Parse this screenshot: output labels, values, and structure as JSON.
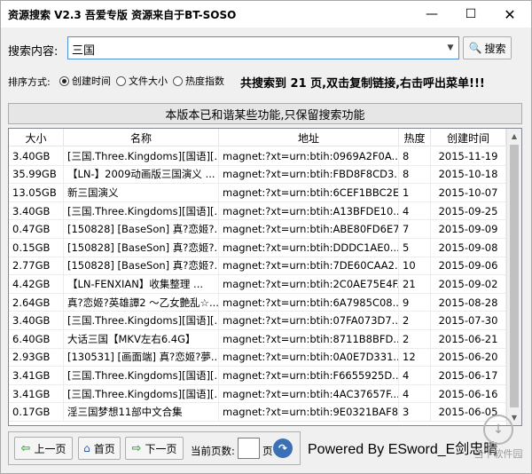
{
  "window": {
    "title": "资源搜索 V2.3 吾爱专版 资源来自于BT-SOSO",
    "minimize_icon": "minimize-icon",
    "maximize_icon": "maximize-icon",
    "close_icon": "close-icon"
  },
  "search": {
    "label": "搜索内容:",
    "value": "三国",
    "button_label": "搜索"
  },
  "sort": {
    "label": "排序方式:",
    "options": [
      "创建时间",
      "文件大小",
      "热度指数"
    ],
    "selected": "创建时间"
  },
  "result_message": "共搜索到 21 页,双击复制链接,右击呼出菜单!!!",
  "notice": "本版本已和谐某些功能,只保留搜索功能",
  "table": {
    "columns": [
      "大小",
      "名称",
      "地址",
      "热度",
      "创建时间"
    ],
    "rows": [
      {
        "size": "3.40GB",
        "name": "[三国.Three.Kingdoms][国语][...",
        "addr": "magnet:?xt=urn:btih:0969A2F0A...",
        "heat": "8",
        "date": "2015-11-19"
      },
      {
        "size": "35.99GB",
        "name": "【LN-】2009动画版三国演义 ...",
        "addr": "magnet:?xt=urn:btih:FBD8F8CD3...",
        "heat": "8",
        "date": "2015-10-18"
      },
      {
        "size": "13.05GB",
        "name": "新三国演义",
        "addr": "magnet:?xt=urn:btih:6CEF1BBC2E...",
        "heat": "1",
        "date": "2015-10-07"
      },
      {
        "size": "3.40GB",
        "name": "[三国.Three.Kingdoms][国语][...",
        "addr": "magnet:?xt=urn:btih:A13BFDE10...",
        "heat": "4",
        "date": "2015-09-25"
      },
      {
        "size": "0.47GB",
        "name": "[150828] [BaseSon] 真?恋姬?...",
        "addr": "magnet:?xt=urn:btih:ABE80FD6E7...",
        "heat": "7",
        "date": "2015-09-09"
      },
      {
        "size": "0.15GB",
        "name": "[150828] [BaseSon] 真?恋姬?...",
        "addr": "magnet:?xt=urn:btih:DDDC1AE0...",
        "heat": "5",
        "date": "2015-09-08"
      },
      {
        "size": "2.77GB",
        "name": "[150828] [BaseSon] 真?恋姬?...",
        "addr": "magnet:?xt=urn:btih:7DE60CAA2...",
        "heat": "10",
        "date": "2015-09-06"
      },
      {
        "size": "4.42GB",
        "name": "【LN-FENXIAN】收集整理 ...",
        "addr": "magnet:?xt=urn:btih:2C0AE75E4F...",
        "heat": "21",
        "date": "2015-09-02"
      },
      {
        "size": "2.64GB",
        "name": "真?恋姬?英雄譚2 ～乙女艶乱☆...",
        "addr": "magnet:?xt=urn:btih:6A7985C08...",
        "heat": "9",
        "date": "2015-08-28"
      },
      {
        "size": "3.40GB",
        "name": "[三国.Three.Kingdoms][国语][...",
        "addr": "magnet:?xt=urn:btih:07FA073D7...",
        "heat": "2",
        "date": "2015-07-30"
      },
      {
        "size": "6.40GB",
        "name": "大话三国【MKV左右6.4G】",
        "addr": "magnet:?xt=urn:btih:8711B8BFD...",
        "heat": "2",
        "date": "2015-06-21"
      },
      {
        "size": "2.93GB",
        "name": "[130531] [画面端] 真?恋姬?夢...",
        "addr": "magnet:?xt=urn:btih:0A0E7D331...",
        "heat": "12",
        "date": "2015-06-20"
      },
      {
        "size": "3.41GB",
        "name": "[三国.Three.Kingdoms][国语][...",
        "addr": "magnet:?xt=urn:btih:F6655925D...",
        "heat": "4",
        "date": "2015-06-17"
      },
      {
        "size": "3.41GB",
        "name": "[三国.Three.Kingdoms][国语][...",
        "addr": "magnet:?xt=urn:btih:4AC37657F...",
        "heat": "4",
        "date": "2015-06-16"
      },
      {
        "size": "0.17GB",
        "name": "淫三国梦想11部中文合集",
        "addr": "magnet:?xt=urn:btih:9E0321BAF8...",
        "heat": "3",
        "date": "2015-06-05"
      }
    ]
  },
  "pager": {
    "prev_label": "上一页",
    "home_label": "首页",
    "next_label": "下一页",
    "current_page_label": "当前页数:",
    "current_page_value": "",
    "page_unit": "页"
  },
  "footer": {
    "powered_by": "Powered By ESword_E剑忠晴",
    "watermark_text": "当下软件园"
  }
}
